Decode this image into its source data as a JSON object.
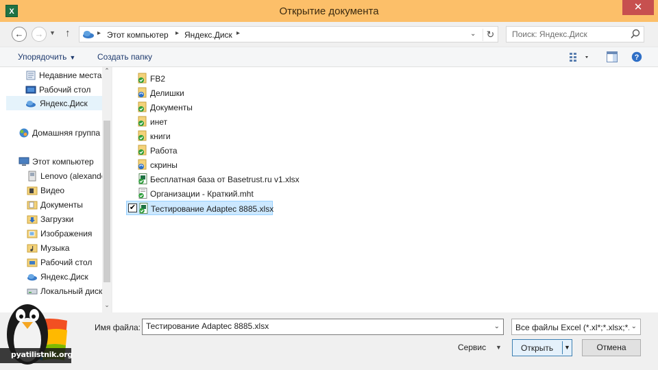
{
  "window": {
    "title": "Открытие документа",
    "app_icon_letter": "X",
    "close_glyph": "✕"
  },
  "address": {
    "crumbs": [
      "Этот компьютер",
      "Яндекс.Диск"
    ],
    "search_placeholder": "Поиск: Яндекс.Диск"
  },
  "toolbar": {
    "organize_label": "Упорядочить",
    "new_folder_label": "Создать папку"
  },
  "sidebar": {
    "items": [
      {
        "label": "Недавние места",
        "icon": "recent-places-icon"
      },
      {
        "label": "Рабочий стол",
        "icon": "desktop-icon"
      },
      {
        "label": "Яндекс.Диск",
        "icon": "yandex-disk-icon",
        "selected": true
      },
      {
        "label": "Домашняя группа",
        "icon": "homegroup-icon"
      },
      {
        "label": "Этот компьютер",
        "icon": "computer-icon"
      },
      {
        "label": "Lenovo (alexande",
        "icon": "user-folder-icon"
      },
      {
        "label": "Видео",
        "icon": "video-folder-icon"
      },
      {
        "label": "Документы",
        "icon": "documents-folder-icon"
      },
      {
        "label": "Загрузки",
        "icon": "downloads-folder-icon"
      },
      {
        "label": "Изображения",
        "icon": "pictures-folder-icon"
      },
      {
        "label": "Музыка",
        "icon": "music-folder-icon"
      },
      {
        "label": "Рабочий стол",
        "icon": "desktop-folder-icon"
      },
      {
        "label": "Яндекс.Диск",
        "icon": "yandex-disk-icon"
      },
      {
        "label": "Локальный диск",
        "icon": "local-disk-icon"
      }
    ]
  },
  "files": [
    {
      "name": "FB2",
      "type": "folder",
      "status": "synced"
    },
    {
      "name": "Делишки",
      "type": "folder",
      "status": "syncing"
    },
    {
      "name": "Документы",
      "type": "folder",
      "status": "synced"
    },
    {
      "name": "инет",
      "type": "folder",
      "status": "synced"
    },
    {
      "name": "книги",
      "type": "folder",
      "status": "synced"
    },
    {
      "name": "Работа",
      "type": "folder",
      "status": "synced"
    },
    {
      "name": "скрины",
      "type": "folder",
      "status": "syncing"
    },
    {
      "name": "Бесплатная база от Basetrust.ru v1.xlsx",
      "type": "xlsx",
      "status": "synced"
    },
    {
      "name": "Организации - Краткий.mht",
      "type": "mht",
      "status": "synced"
    },
    {
      "name": "Тестирование Adaptec 8885.xlsx",
      "type": "xlsx",
      "status": "synced",
      "selected": true,
      "checked": true
    }
  ],
  "bottom": {
    "filename_label": "Имя файла:",
    "filename_value": "Тестирование Adaptec 8885.xlsx",
    "filetype_value": "Все файлы Excel (*.xl*;*.xlsx;*.xl",
    "service_label": "Сервис",
    "open_label": "Открыть",
    "cancel_label": "Отмена"
  },
  "watermark": {
    "text": "pyatilistnik.org"
  },
  "colors": {
    "titlebar": "#fcbf69",
    "close_button": "#c7504f",
    "selection": "#cce8ff",
    "link_text": "#1e3a6e",
    "sync_ok": "#2e9e3a",
    "sync_pending": "#2a6fc9"
  }
}
